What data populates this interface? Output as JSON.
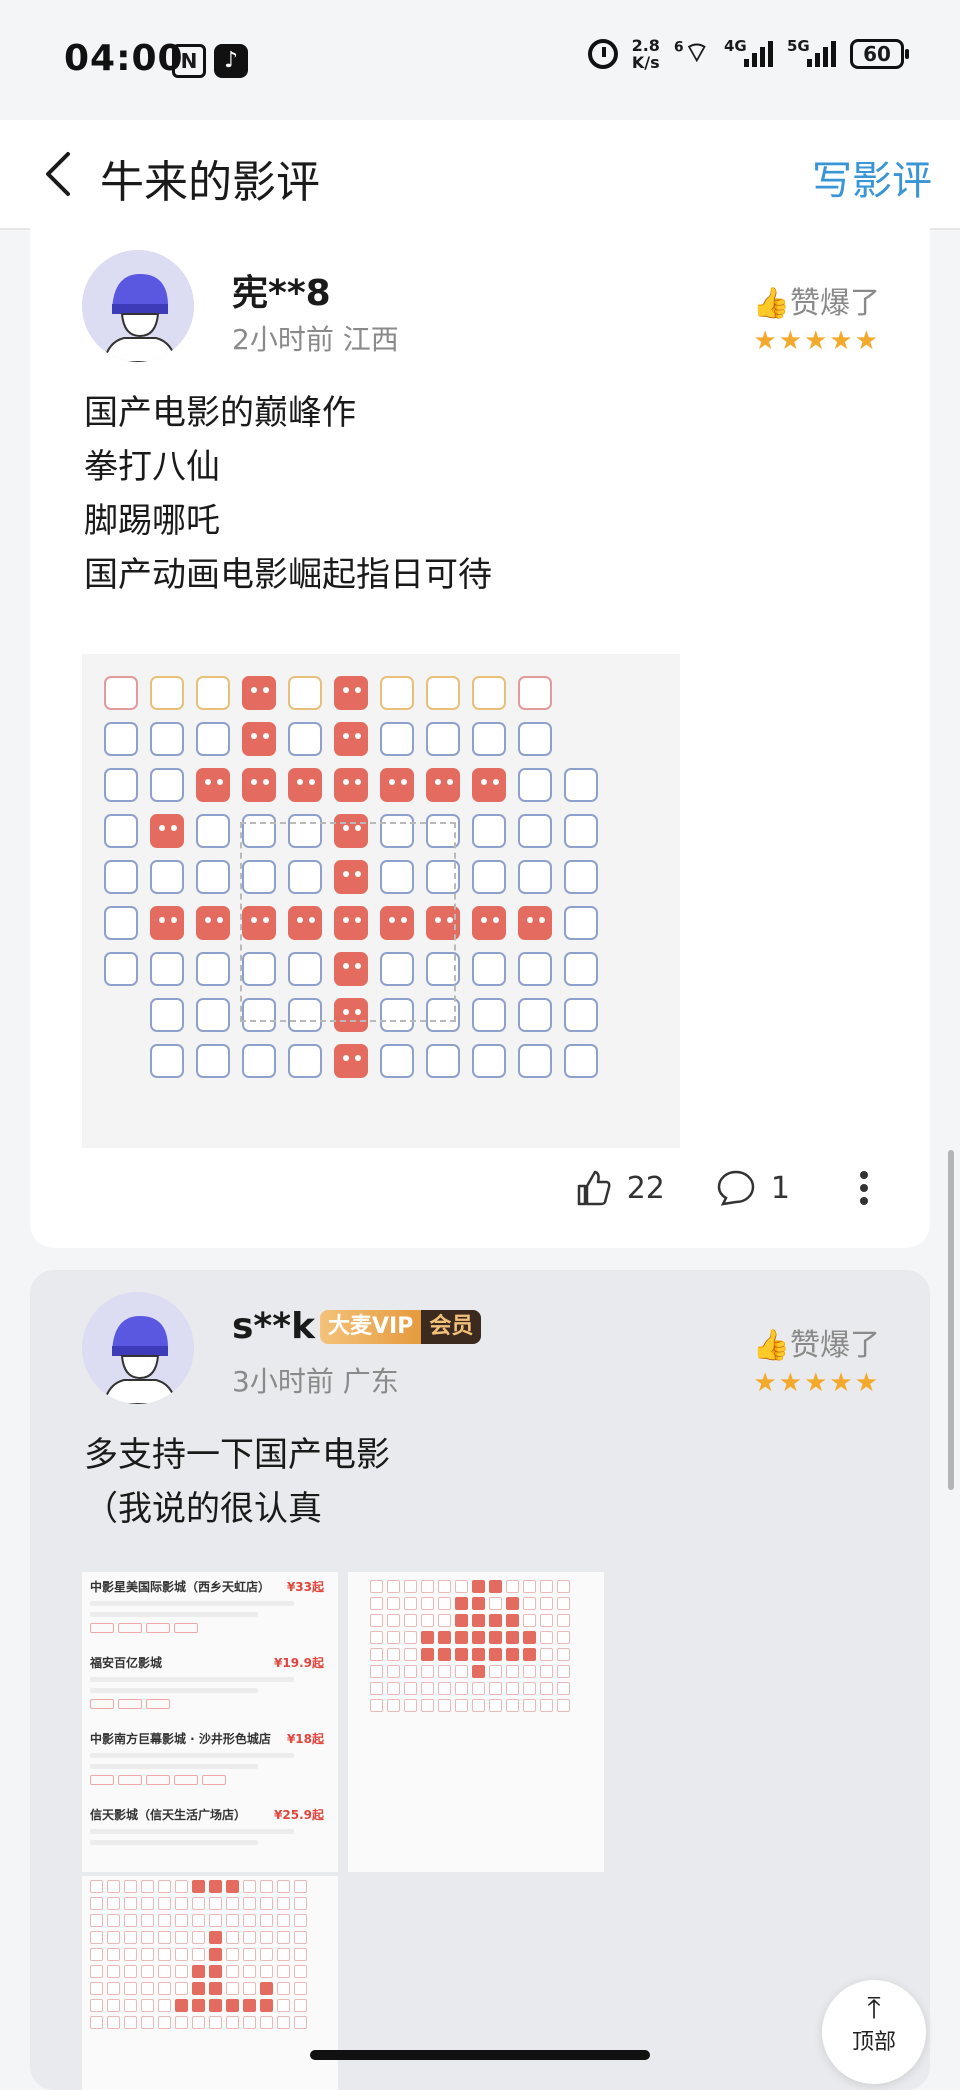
{
  "status_bar": {
    "time": "04:00",
    "nfc": "N",
    "speed_top": "2.8",
    "speed_bottom": "K/s",
    "wifi_badge": "6",
    "sig1": "4G",
    "sig2": "5G",
    "battery": "60"
  },
  "nav": {
    "title": "牛来的影评",
    "write_label": "写影评"
  },
  "reviews": [
    {
      "user": "宪**8",
      "time": "2小时前",
      "region": "江西",
      "rating_label": "赞爆了",
      "stars": "★★★★★",
      "lines": [
        "国产电影的巅峰作",
        "拳打八仙",
        "脚踢哪吒",
        "国产动画电影崛起指日可待"
      ],
      "likes": "22",
      "comments": "1"
    },
    {
      "user": "s**k",
      "vip_a": "大麦VIP",
      "vip_b": "会员",
      "time": "3小时前",
      "region": "广东",
      "rating_label": "赞爆了",
      "stars": "★★★★★",
      "lines": [
        "多支持一下国产电影",
        "（我说的很认真"
      ]
    }
  ],
  "cinemas": [
    {
      "name": "中影星美国际影城（西乡天虹店）",
      "price": "¥33起"
    },
    {
      "name": "福安百亿影城",
      "price": "¥19.9起"
    },
    {
      "name": "中影南方巨幕影城 · 沙井形色城店",
      "price": "¥18起"
    },
    {
      "name": "信天影城（信天生活广场店）",
      "price": "¥25.9起"
    }
  ],
  "back_to_top": "顶部",
  "colors": {
    "accent": "#3a95d6",
    "star": "#f3a92c",
    "seat_taken": "#e36b5f"
  }
}
